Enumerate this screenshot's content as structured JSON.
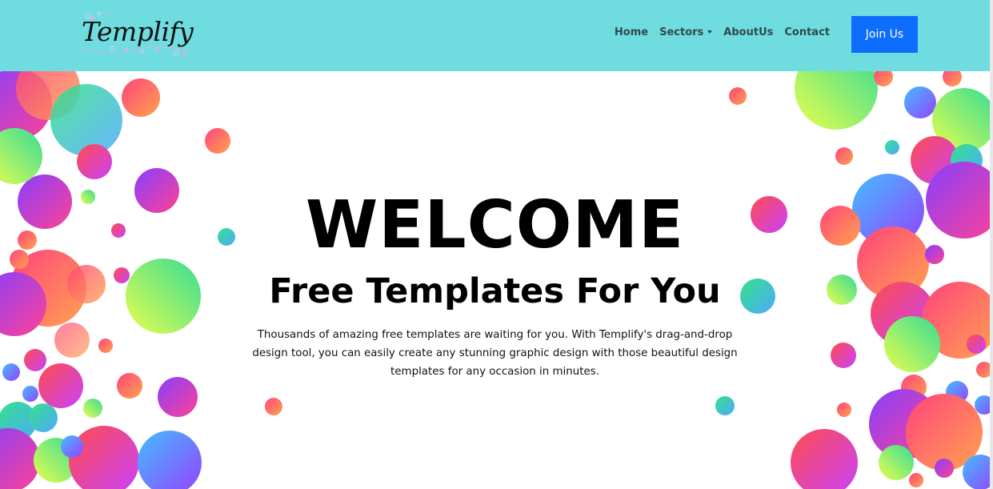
{
  "brand": {
    "logo_text": "Templify"
  },
  "nav": {
    "items": [
      {
        "label": "Home"
      },
      {
        "label": "Sectors"
      },
      {
        "label": "AboutUs"
      },
      {
        "label": "Contact"
      }
    ],
    "join_label": "Join Us"
  },
  "hero": {
    "title": "WELCOME",
    "subtitle": "Free Templates For You",
    "description": "Thousands of amazing free templates are waiting for you. With Templify's drag-and-drop design tool, you can easily create any stunning graphic design with those beautiful design templates for any occasion in minutes."
  },
  "colors": {
    "navbar_bg": "#6fdcdf",
    "button_bg": "#0d6efd",
    "nav_text": "#2e4a4c"
  },
  "icons": [
    "dropdown-caret-icon"
  ]
}
